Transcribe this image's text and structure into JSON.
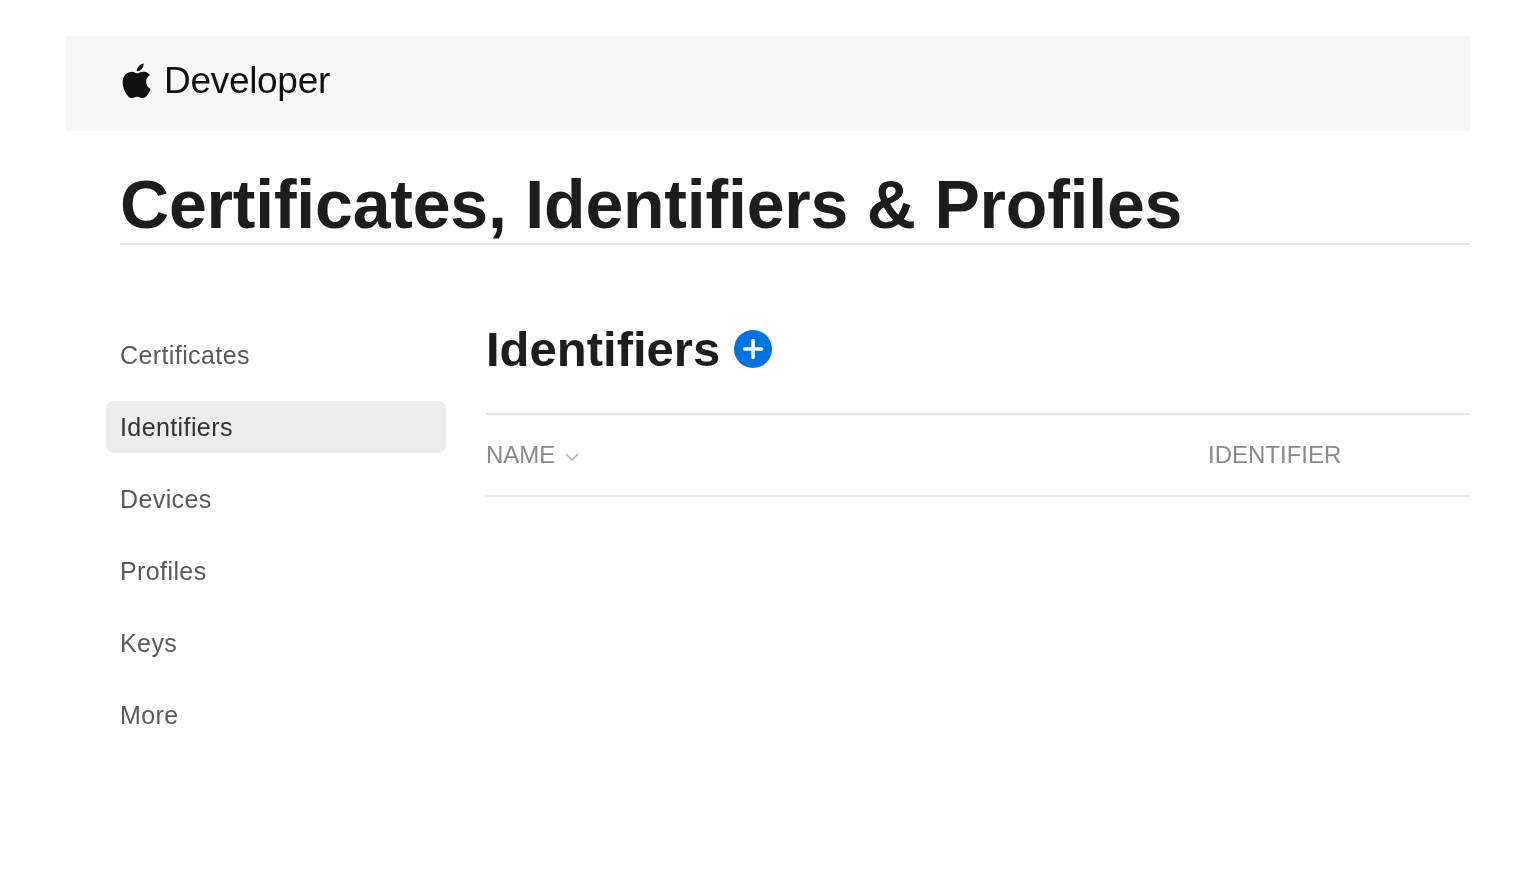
{
  "header": {
    "brand": "Developer"
  },
  "page_title": "Certificates, Identifiers & Profiles",
  "sidebar": {
    "items": [
      {
        "label": "Certificates",
        "selected": false
      },
      {
        "label": "Identifiers",
        "selected": true
      },
      {
        "label": "Devices",
        "selected": false
      },
      {
        "label": "Profiles",
        "selected": false
      },
      {
        "label": "Keys",
        "selected": false
      },
      {
        "label": "More",
        "selected": false
      }
    ]
  },
  "section": {
    "title": "Identifiers",
    "table": {
      "columns": [
        {
          "label": "NAME",
          "sorted": true
        },
        {
          "label": "IDENTIFIER",
          "sorted": false
        }
      ]
    }
  }
}
